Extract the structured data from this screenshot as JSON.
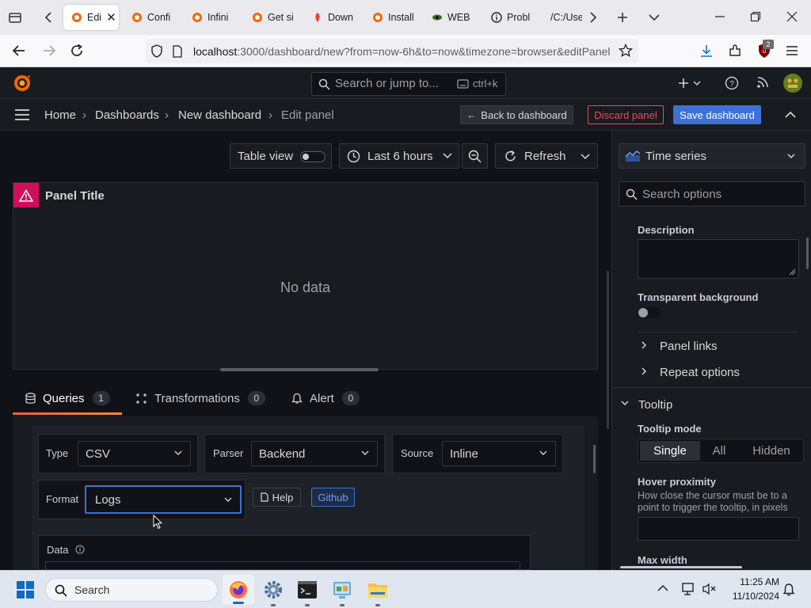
{
  "browser": {
    "tabs": [
      {
        "label": "Edi",
        "active": true,
        "icon": "grafana-icon"
      },
      {
        "label": "Confi",
        "icon": "grafana-icon"
      },
      {
        "label": "Infini",
        "icon": "grafana-icon"
      },
      {
        "label": "Get si",
        "icon": "grafana-icon"
      },
      {
        "label": "Down",
        "icon": "download-icon"
      },
      {
        "label": "Install",
        "icon": "grafana-icon"
      },
      {
        "label": "WEB",
        "icon": "eye-icon"
      },
      {
        "label": "Probl",
        "icon": "info-icon"
      },
      {
        "label": "/C:/Use",
        "icon": "file-icon"
      }
    ],
    "url_host": "localhost",
    "url_rest": ":3000/dashboard/new?from=now-6h&to=now&timezone=browser&editPanel",
    "extension_badge": "2"
  },
  "grafana": {
    "search_placeholder": "Search or jump to...",
    "search_shortcut": "ctrl+k",
    "breadcrumb": [
      "Home",
      "Dashboards",
      "New dashboard",
      "Edit panel"
    ],
    "back_label": "Back to dashboard",
    "discard_label": "Discard panel",
    "save_label": "Save dashboard",
    "toolbar": {
      "table_view": "Table view",
      "time_range": "Last 6 hours",
      "refresh": "Refresh"
    },
    "panel": {
      "title": "Panel Title",
      "empty": "No data"
    },
    "query_tabs": [
      {
        "label": "Queries",
        "count": "1"
      },
      {
        "label": "Transformations",
        "count": "0"
      },
      {
        "label": "Alert",
        "count": "0"
      }
    ],
    "query": {
      "type_label": "Type",
      "type_value": "CSV",
      "parser_label": "Parser",
      "parser_value": "Backend",
      "source_label": "Source",
      "source_value": "Inline",
      "format_label": "Format",
      "format_value": "Logs",
      "help_label": "Help",
      "github_label": "Github",
      "data_label": "Data"
    },
    "options": {
      "visualization": "Time series",
      "search_placeholder": "Search options",
      "description_label": "Description",
      "transparent_label": "Transparent background",
      "panel_links": "Panel links",
      "repeat_options": "Repeat options",
      "tooltip_section": "Tooltip",
      "tooltip_mode_label": "Tooltip mode",
      "tooltip_modes": [
        "Single",
        "All",
        "Hidden"
      ],
      "hover_label": "Hover proximity",
      "hover_desc": "How close the cursor must be to a point to trigger the tooltip, in pixels",
      "max_width_label": "Max width"
    }
  },
  "taskbar": {
    "search_label": "Search",
    "time": "11:25 AM",
    "date": "11/10/2024"
  },
  "colors": {
    "grafana_bg": "#111217",
    "accent_blue": "#3d71d9",
    "discard_red": "#f2495c",
    "warning_pink": "#d10e5c"
  }
}
